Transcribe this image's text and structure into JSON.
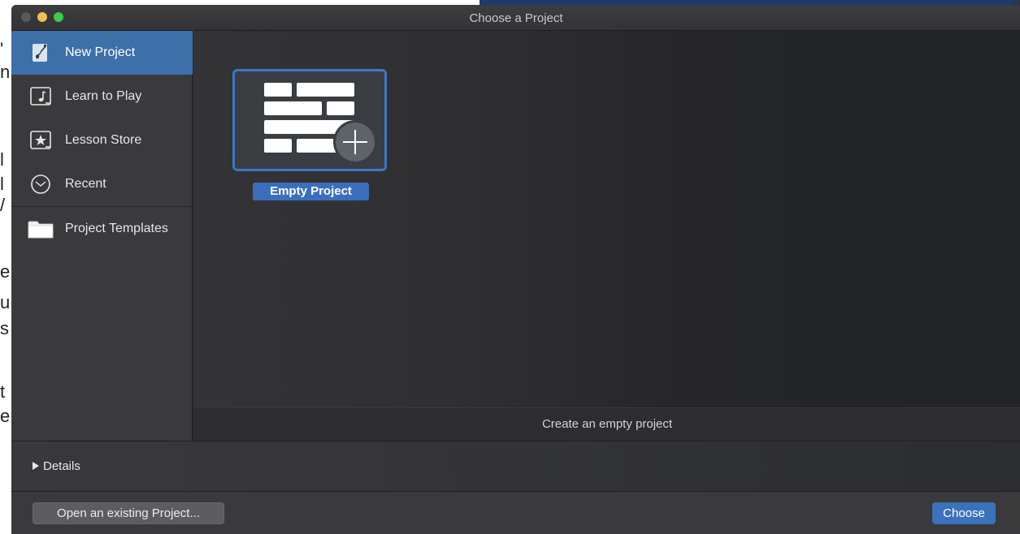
{
  "window": {
    "title": "Choose a Project"
  },
  "sidebar": {
    "items": [
      {
        "label": "New Project",
        "icon": "guitar-document-icon",
        "selected": true
      },
      {
        "label": "Learn to Play",
        "icon": "music-note-icon",
        "selected": false
      },
      {
        "label": "Lesson Store",
        "icon": "star-icon",
        "selected": false
      },
      {
        "label": "Recent",
        "icon": "clock-icon",
        "selected": false
      },
      {
        "label": "Project Templates",
        "icon": "folder-icon",
        "selected": false
      }
    ]
  },
  "main": {
    "tiles": [
      {
        "label": "Empty Project",
        "icon": "empty-project-add-icon",
        "selected": true
      }
    ],
    "description": "Create an empty project"
  },
  "details": {
    "label": "Details",
    "expanded": false
  },
  "footer": {
    "open_label": "Open an existing Project...",
    "choose_label": "Choose"
  },
  "colors": {
    "accent": "#3b6ebd",
    "window_bg": "#2b2b2d",
    "sidebar_bg": "#3a3a3c"
  }
}
